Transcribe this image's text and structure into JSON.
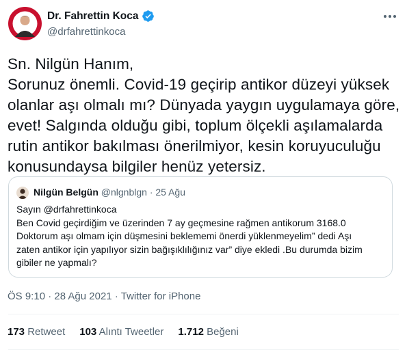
{
  "author": {
    "display_name": "Dr. Fahrettin Koca",
    "handle": "@drfahrettinkoca",
    "verified": true,
    "avatar_icon": "profile-photo"
  },
  "tweet": {
    "lines": [
      "Sn. Nilgün Hanım,",
      "Sorunuz önemli. Covid-19 geçirip antikor düzeyi yüksek",
      "olanlar aşı olmalı mı? Dünyada yaygın uygulamaya göre,",
      "evet! Salgında olduğu gibi, toplum ölçekli aşılamalarda",
      "rutin antikor bakılması önerilmiyor, kesin koruyuculuğu",
      "konusundaysa bilgiler henüz yetersiz."
    ]
  },
  "quote": {
    "display_name": "Nilgün Belgün",
    "handle": "@nlgnblgn",
    "separator": "·",
    "date": "25 Ağu",
    "lines": [
      "Sayın @drfahrettinkoca",
      "Ben Covid geçirdiğim ve üzerinden 7 ay geçmesine rağmen antikorum 3168.0",
      "Doktorum aşı olmam için düşmesini beklememi önerdi yüklenmeyelim” dedi Aşı",
      "zaten antikor için yapılıyor sizin bağışıklılığınız var” diye ekledi .Bu durumda bizim",
      "gibiler ne yapmalı?"
    ]
  },
  "meta": {
    "time": "ÖS 9:10",
    "date": "28 Ağu 2021",
    "source": "Twitter for iPhone",
    "separator": "·"
  },
  "stats": {
    "retweets_count": "173",
    "retweets_label": "Retweet",
    "quotes_count": "103",
    "quotes_label": "Alıntı Tweetler",
    "likes_count": "1.712",
    "likes_label": "Beğeni"
  },
  "colors": {
    "text": "#0f1419",
    "secondary": "#536471",
    "verified": "#1d9bf0",
    "border": "#cfd9de"
  }
}
